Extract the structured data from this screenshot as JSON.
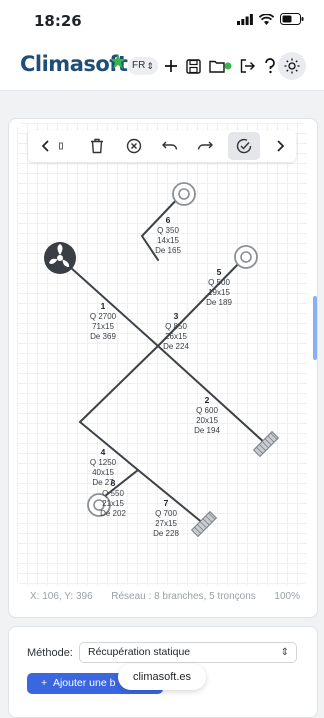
{
  "status_bar": {
    "time": "18:26"
  },
  "app": {
    "logo_text": "Climasoft",
    "language": "FR",
    "accent_color": "#1f4e78",
    "leaf_color": "#39b54a"
  },
  "toolbar": {
    "icons": [
      "chevron-left-icon",
      "trash-icon",
      "close-circle-icon",
      "undo-icon",
      "redo-icon",
      "check-circle-icon",
      "chevron-right-icon"
    ]
  },
  "diagram": {
    "branches": [
      {
        "n": "1",
        "q": "Q 2700",
        "size": "71x15",
        "de": "De 369"
      },
      {
        "n": "2",
        "q": "Q 600",
        "size": "20x15",
        "de": "De 194"
      },
      {
        "n": "3",
        "q": "Q 850",
        "size": "26x15",
        "de": "De 224"
      },
      {
        "n": "4",
        "q": "Q 1250",
        "size": "40x15",
        "de": "De 27"
      },
      {
        "n": "5",
        "q": "Q 500",
        "size": "19x15",
        "de": "De 189"
      },
      {
        "n": "6",
        "q": "Q 350",
        "size": "14x15",
        "de": "De 165"
      },
      {
        "n": "7",
        "q": "Q 700",
        "size": "27x15",
        "de": "De 228"
      },
      {
        "n": "8",
        "q": "Q 550",
        "size": "21x15",
        "de": "De 202"
      }
    ]
  },
  "canvas_status": {
    "coords": "X: 106, Y: 396",
    "network": "Réseau : 8 branches, 5 tronçons",
    "zoom": "100%"
  },
  "method": {
    "label": "Méthode:",
    "selected": "Récupération statique"
  },
  "add_button": {
    "label": "Ajouter une b"
  },
  "toast": {
    "text": "climasoft.es"
  }
}
